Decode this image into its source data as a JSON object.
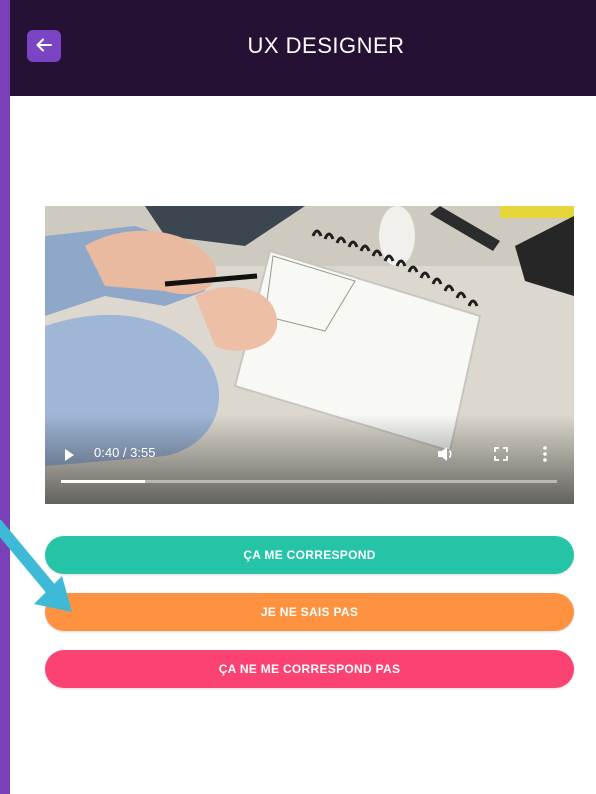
{
  "header": {
    "title": "UX DESIGNER",
    "back_icon": "arrow-left-icon",
    "background": "#241133",
    "back_button_color": "#7a44c4"
  },
  "video": {
    "time_display": "0:40 / 3:55",
    "current_seconds": 40,
    "duration_seconds": 235,
    "progress_fraction": 0.17,
    "icons": [
      "play-icon",
      "volume-icon",
      "fullscreen-icon",
      "more-vert-icon"
    ]
  },
  "choices": {
    "yes_label": "ÇA ME CORRESPOND",
    "maybe_label": "JE NE SAIS PAS",
    "no_label": "ÇA NE ME CORRESPOND PAS",
    "colors": {
      "yes": "#25c4a7",
      "maybe": "#ff9240",
      "no": "#fc4272"
    }
  },
  "annotation": {
    "arrow_icon": "pointer-arrow-icon",
    "arrow_color": "#3fb9d8"
  },
  "page_background": "#7b3fb8"
}
